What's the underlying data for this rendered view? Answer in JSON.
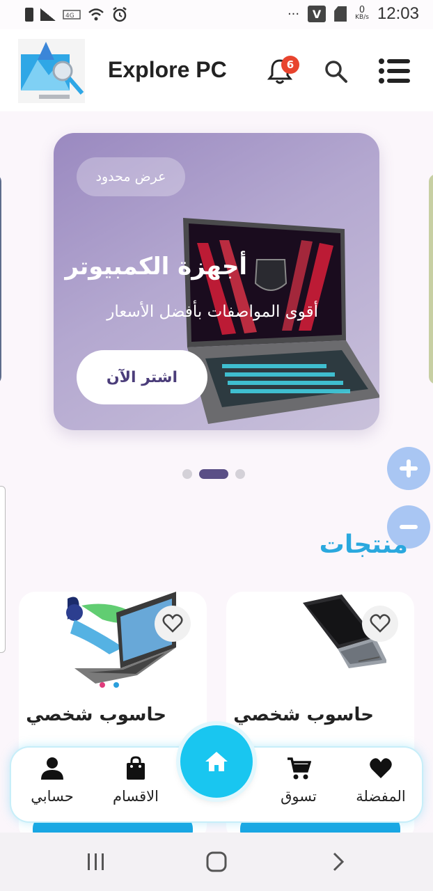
{
  "status_bar": {
    "time": "12:03",
    "carrier_icon_letter": "V",
    "data_speed_value": "0",
    "data_speed_unit": "KB/s"
  },
  "header": {
    "app_title": "Explore PC",
    "notification_count": "6"
  },
  "banner": {
    "offer_label": "عرض محدود",
    "title": "أجهزة الكمبيوتر",
    "subtitle": "أقوى المواصفات بأفضل الأسعار",
    "cta_label": "اشتر الآن",
    "active_slide": 2,
    "slide_count": 3
  },
  "section": {
    "title": "منتجات"
  },
  "products": [
    {
      "name": "حاسوب شخصي",
      "price": "",
      "favorite": false
    },
    {
      "name": "حاسوب شخصي",
      "price": "",
      "favorite": false
    }
  ],
  "bottom_nav": {
    "favorites_label": "المفضلة",
    "shop_label": "تسوق",
    "categories_label": "الاقسام",
    "account_label": "حسابي",
    "active": "home"
  },
  "colors": {
    "accent": "#2aa8de",
    "fab": "#19c6f0",
    "banner_purple": "#9a89c0",
    "badge_red": "#e8442e",
    "cta_text": "#4b3d7a"
  },
  "icons": {
    "logo": "explore-pc-logo",
    "bell": "bell-icon",
    "search": "search-icon",
    "menu": "list-menu-icon",
    "fav": "heart-icon",
    "shop": "cart-icon",
    "categories": "bag-icon",
    "account": "person-icon",
    "home": "home-icon"
  }
}
